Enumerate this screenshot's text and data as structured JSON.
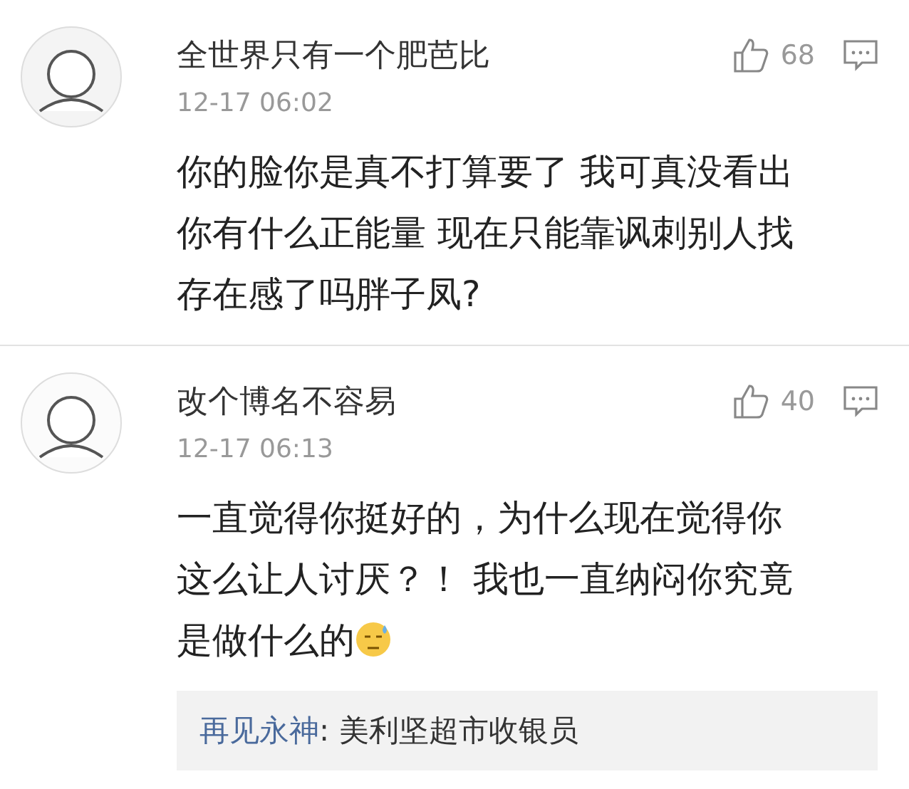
{
  "comments": [
    {
      "name": "全世界只有一个肥芭比",
      "time": "12-17 06:02",
      "likes": "68",
      "body_lines": [
        "你的脸你是真不打算要了 我可真没看出",
        "你有什么正能量 现在只能靠讽刺别人找",
        "存在感了吗胖子凤?"
      ],
      "has_emoji": false
    },
    {
      "name": "改个博名不容易",
      "time": "12-17 06:13",
      "likes": "40",
      "body_lines": [
        "一直觉得你挺好的，为什么现在觉得你",
        "这么让人讨厌？！ 我也一直纳闷你究竟",
        "是做什么的"
      ],
      "has_emoji": true,
      "reply": {
        "author": "再见永神",
        "text": ": 美利坚超市收银员"
      }
    }
  ]
}
